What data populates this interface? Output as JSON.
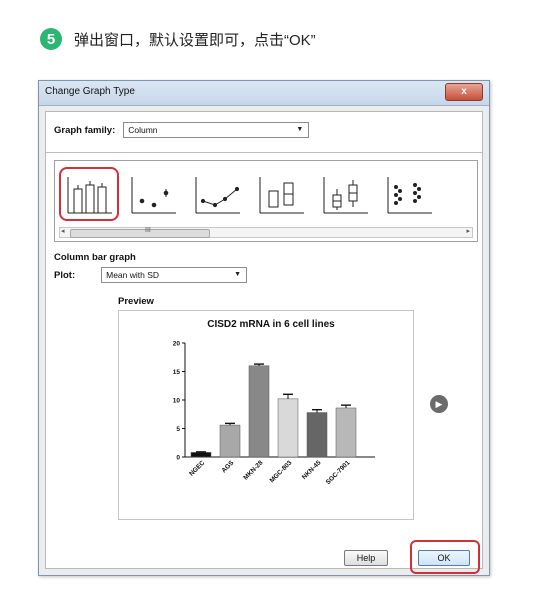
{
  "instruction": {
    "step_number": "5",
    "text": "弹出窗口，默认设置即可，点击“OK”"
  },
  "dialog": {
    "title": "Change Graph Type",
    "close_label": "x",
    "graph_family_label": "Graph family:",
    "graph_family_value": "Column",
    "gallery_scroll_grip": "III",
    "section_label": "Column bar graph",
    "plot_label": "Plot:",
    "plot_value": "Mean with SD",
    "preview_label": "Preview",
    "help_label": "Help",
    "ok_label": "OK"
  },
  "accent_color": "#d62e3a",
  "chart_data": {
    "type": "bar",
    "title": "CISD2 mRNA in 6 cell lines",
    "categories": [
      "NGEC",
      "AGS",
      "MKN-28",
      "MGC-803",
      "NKN-45",
      "SGC-7901"
    ],
    "values": [
      0.8,
      5.6,
      16.0,
      10.2,
      7.8,
      8.6
    ],
    "errors": [
      0.1,
      0.3,
      0.3,
      0.8,
      0.5,
      0.5
    ],
    "colors": [
      "#111111",
      "#a8a8a8",
      "#888888",
      "#d9d9d9",
      "#666666",
      "#b8b8b8"
    ],
    "ylim": [
      0,
      20
    ],
    "yticks": [
      0,
      5,
      10,
      15,
      20
    ],
    "xlabel": "",
    "ylabel": ""
  }
}
